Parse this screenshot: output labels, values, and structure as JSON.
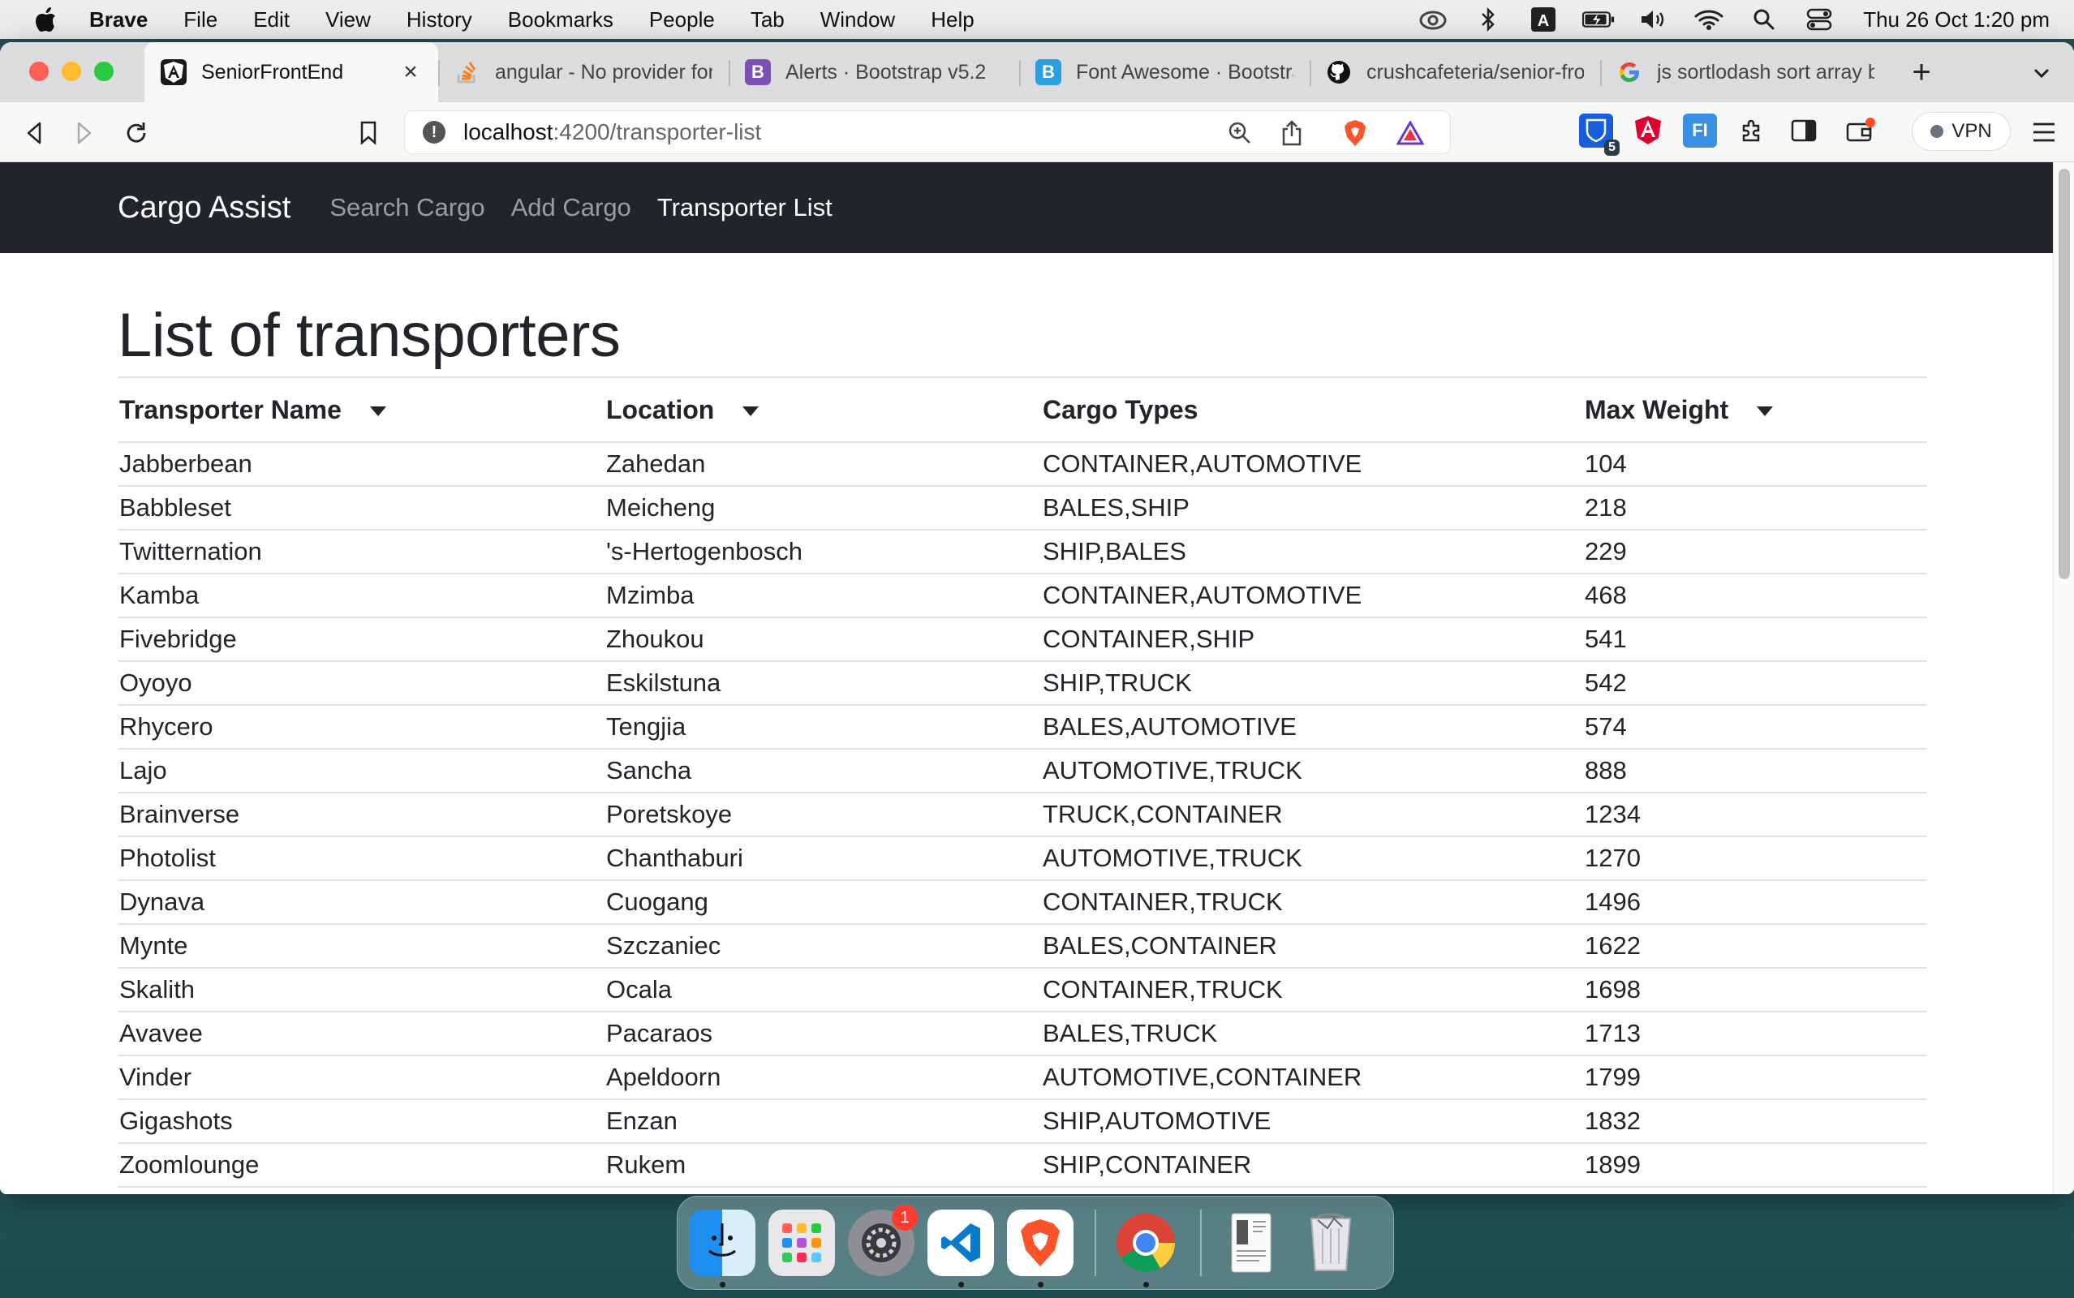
{
  "menubar": {
    "app_name": "Brave",
    "items": [
      "File",
      "Edit",
      "View",
      "History",
      "Bookmarks",
      "People",
      "Tab",
      "Window",
      "Help"
    ],
    "clock": "Thu 26 Oct  1:20 pm"
  },
  "browser": {
    "tabs": [
      {
        "title": "SeniorFrontEnd",
        "icon": "angular-icon",
        "active": true
      },
      {
        "title": "angular - No provider for",
        "icon": "stackoverflow-icon"
      },
      {
        "title": "Alerts · Bootstrap v5.2",
        "icon": "bootstrap-icon"
      },
      {
        "title": "Font Awesome · Bootstra",
        "icon": "bootstrap-blue-icon"
      },
      {
        "title": "crushcafeteria/senior-fro",
        "icon": "github-icon"
      },
      {
        "title": "js sortlodash sort array b",
        "icon": "google-icon"
      }
    ],
    "url_host": "localhost",
    "url_path": ":4200/transporter-list",
    "vpn_label": "VPN",
    "extension_badge": "5"
  },
  "app": {
    "brand": "Cargo Assist",
    "nav": [
      {
        "label": "Search Cargo",
        "active": false
      },
      {
        "label": "Add Cargo",
        "active": false
      },
      {
        "label": "Transporter List",
        "active": true
      }
    ],
    "heading": "List of transporters",
    "table": {
      "columns": [
        {
          "label": "Transporter Name",
          "sortable": true
        },
        {
          "label": "Location",
          "sortable": true
        },
        {
          "label": "Cargo Types",
          "sortable": false
        },
        {
          "label": "Max Weight",
          "sortable": true
        }
      ],
      "rows": [
        [
          "Jabberbean",
          "Zahedan",
          "CONTAINER,AUTOMOTIVE",
          "104"
        ],
        [
          "Babbleset",
          "Meicheng",
          "BALES,SHIP",
          "218"
        ],
        [
          "Twitternation",
          "'s-Hertogenbosch",
          "SHIP,BALES",
          "229"
        ],
        [
          "Kamba",
          "Mzimba",
          "CONTAINER,AUTOMOTIVE",
          "468"
        ],
        [
          "Fivebridge",
          "Zhoukou",
          "CONTAINER,SHIP",
          "541"
        ],
        [
          "Oyoyo",
          "Eskilstuna",
          "SHIP,TRUCK",
          "542"
        ],
        [
          "Rhycero",
          "Tengjia",
          "BALES,AUTOMOTIVE",
          "574"
        ],
        [
          "Lajo",
          "Sancha",
          "AUTOMOTIVE,TRUCK",
          "888"
        ],
        [
          "Brainverse",
          "Poretskoye",
          "TRUCK,CONTAINER",
          "1234"
        ],
        [
          "Photolist",
          "Chanthaburi",
          "AUTOMOTIVE,TRUCK",
          "1270"
        ],
        [
          "Dynava",
          "Cuogang",
          "CONTAINER,TRUCK",
          "1496"
        ],
        [
          "Mynte",
          "Szczaniec",
          "BALES,CONTAINER",
          "1622"
        ],
        [
          "Skalith",
          "Ocala",
          "CONTAINER,TRUCK",
          "1698"
        ],
        [
          "Avavee",
          "Pacaraos",
          "BALES,TRUCK",
          "1713"
        ],
        [
          "Vinder",
          "Apeldoorn",
          "AUTOMOTIVE,CONTAINER",
          "1799"
        ],
        [
          "Gigashots",
          "Enzan",
          "SHIP,AUTOMOTIVE",
          "1832"
        ],
        [
          "Zoomlounge",
          "Rukem",
          "SHIP,CONTAINER",
          "1899"
        ]
      ]
    }
  },
  "dock": {
    "apps": [
      "finder-icon",
      "launchpad-icon",
      "system-settings-icon",
      "vscode-icon",
      "brave-icon",
      "chrome-icon",
      "preview-doc-icon",
      "trash-icon"
    ],
    "settings_badge": "1"
  }
}
